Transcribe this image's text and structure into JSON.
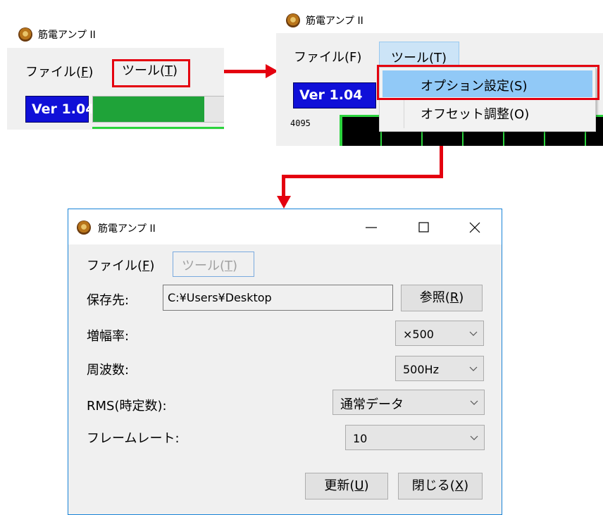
{
  "app_title": "筋電アンプ II",
  "menu": {
    "file": "ファイル(",
    "file_key": "F",
    "tool": "ツール(",
    "tool_key": "T",
    "close_paren": ")"
  },
  "top_right": {
    "file_label": "ファイル(F)",
    "tool_label": "ツール(T)",
    "dropdown": [
      "オプション設定(S)",
      "オフセット調整(O)"
    ],
    "axis_max": "4095"
  },
  "version": "Ver 1.04",
  "progress_fraction": 0.83,
  "dialog": {
    "save_label": "保存先:",
    "save_path": "C:¥Users¥Desktop",
    "browse_button": "参照(",
    "browse_key": "R",
    "gain_label": "増幅率:",
    "gain_value": "×500",
    "freq_label": "周波数:",
    "freq_value": "500Hz",
    "rms_label": "RMS(時定数):",
    "rms_value": "通常データ",
    "frame_label": "フレームレート:",
    "frame_value": "10",
    "update_button": "更新(",
    "update_key": "U",
    "close_button": "閉じる(",
    "close_key": "X"
  },
  "colors": {
    "highlight": "#e4000f",
    "version_bg": "#1010d8",
    "progress": "#1fa339"
  }
}
